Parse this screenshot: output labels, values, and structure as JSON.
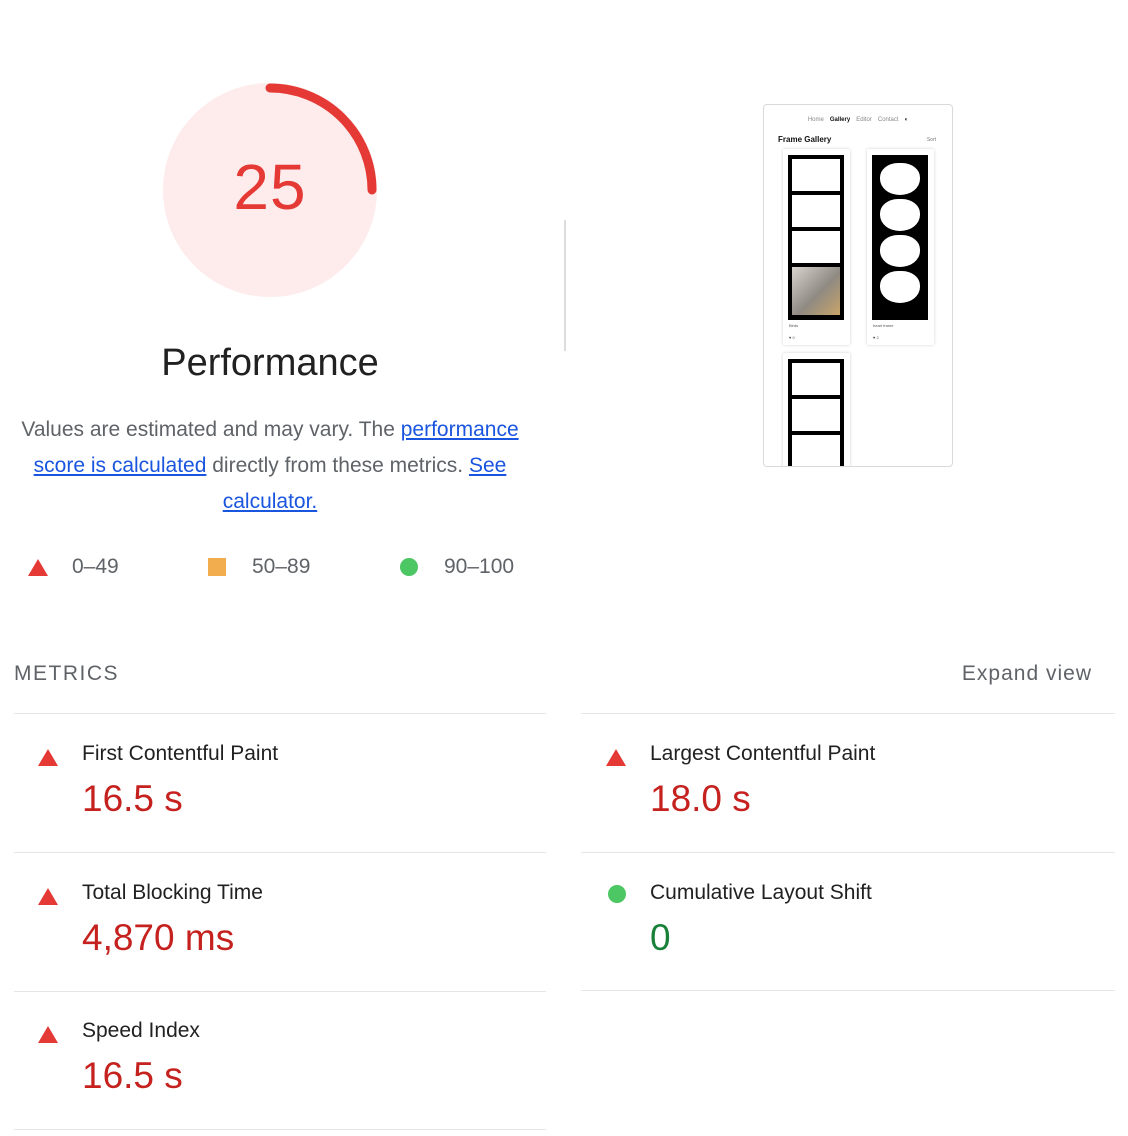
{
  "score": {
    "value": "25",
    "fraction": 0.25,
    "color": "#e53935",
    "bg_color": "#fdeceb"
  },
  "title": "Performance",
  "description": {
    "prefix": "Values are estimated and may vary. The ",
    "link1": "performance score is calculated",
    "middle": " directly from these metrics. ",
    "link2": "See calculator."
  },
  "legend": [
    {
      "range": "0–49",
      "icon": "triangle-icon",
      "color": "#e53935"
    },
    {
      "range": "50–89",
      "icon": "square-icon",
      "color": "#f2ad4e"
    },
    {
      "range": "90–100",
      "icon": "circle-icon",
      "color": "#4cc763"
    }
  ],
  "screenshot": {
    "nav": [
      "Home",
      "Gallery",
      "Editor",
      "Contact"
    ],
    "active_nav": "Gallery",
    "title": "Frame Gallery",
    "sort": "Sort",
    "cards": [
      {
        "name": "Birds",
        "likes": "0"
      },
      {
        "name": "heart frame",
        "likes": "2"
      }
    ]
  },
  "metrics": {
    "heading": "METRICS",
    "expand_label": "Expand view",
    "items": [
      {
        "label": "First Contentful Paint",
        "value": "16.5 s",
        "status": "poor"
      },
      {
        "label": "Largest Contentful Paint",
        "value": "18.0 s",
        "status": "poor"
      },
      {
        "label": "Total Blocking Time",
        "value": "4,870 ms",
        "status": "poor"
      },
      {
        "label": "Cumulative Layout Shift",
        "value": "0",
        "status": "good"
      },
      {
        "label": "Speed Index",
        "value": "16.5 s",
        "status": "poor"
      }
    ]
  }
}
